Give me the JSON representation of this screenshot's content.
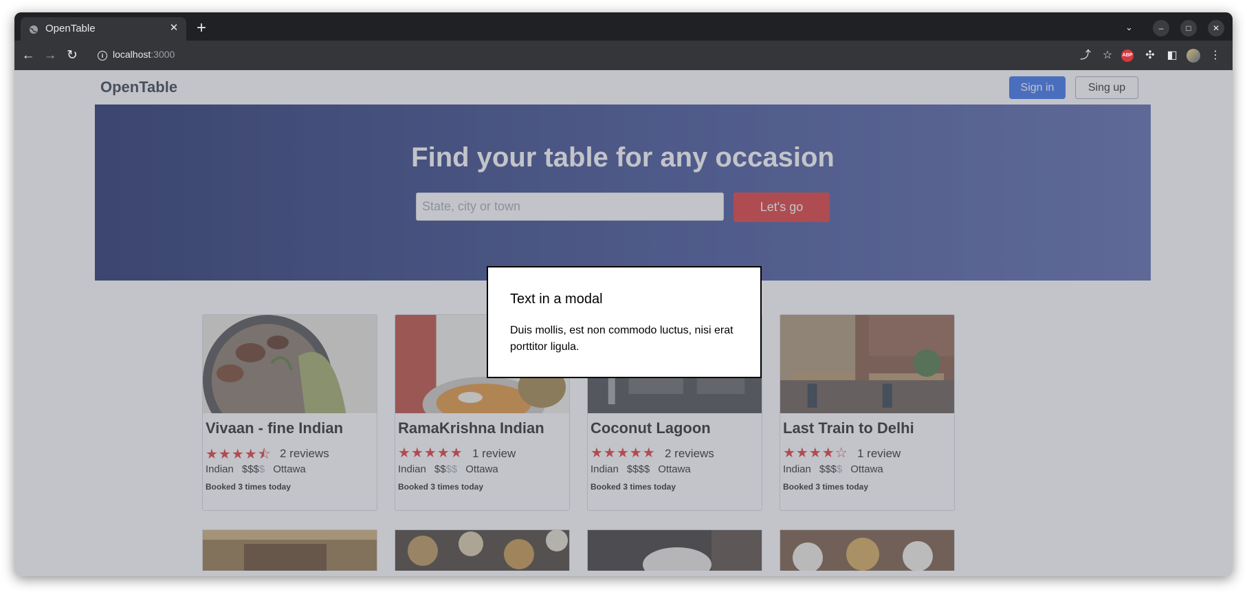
{
  "browser": {
    "tab_title": "OpenTable",
    "url_host": "localhost",
    "url_port": ":3000"
  },
  "site": {
    "logo": "OpenTable",
    "sign_in": "Sign in",
    "sign_up": "Sing up"
  },
  "hero": {
    "title": "Find your table for any occasion",
    "search_placeholder": "State, city or town",
    "button": "Let's go"
  },
  "restaurants": [
    {
      "name": "Vivaan - fine Indian",
      "rating": 4.5,
      "stars": "★★★★⯪",
      "reviews": "2 reviews",
      "cuisine": "Indian",
      "price_on": "$$$",
      "price_off": "$",
      "city": "Ottawa",
      "booked": "Booked 3 times today"
    },
    {
      "name": "RamaKrishna Indian",
      "rating": 5,
      "stars": "★★★★★",
      "reviews": "1 review",
      "cuisine": "Indian",
      "price_on": "$$",
      "price_off": "$$",
      "city": "Ottawa",
      "booked": "Booked 3 times today"
    },
    {
      "name": "Coconut Lagoon",
      "rating": 5,
      "stars": "★★★★★",
      "reviews": "2 reviews",
      "cuisine": "Indian",
      "price_on": "$$$$",
      "price_off": "",
      "city": "Ottawa",
      "booked": "Booked 3 times today"
    },
    {
      "name": "Last Train to Delhi",
      "rating": 4,
      "stars": "★★★★☆",
      "reviews": "1 review",
      "cuisine": "Indian",
      "price_on": "$$$",
      "price_off": "$",
      "city": "Ottawa",
      "booked": "Booked 3 times today"
    }
  ],
  "modal": {
    "title": "Text in a modal",
    "body": "Duis mollis, est non commodo luctus, nisi erat porttitor ligula."
  },
  "colors": {
    "accent_red": "#dc2626",
    "accent_blue": "#2563eb",
    "hero_dark": "#0b1a5c"
  }
}
